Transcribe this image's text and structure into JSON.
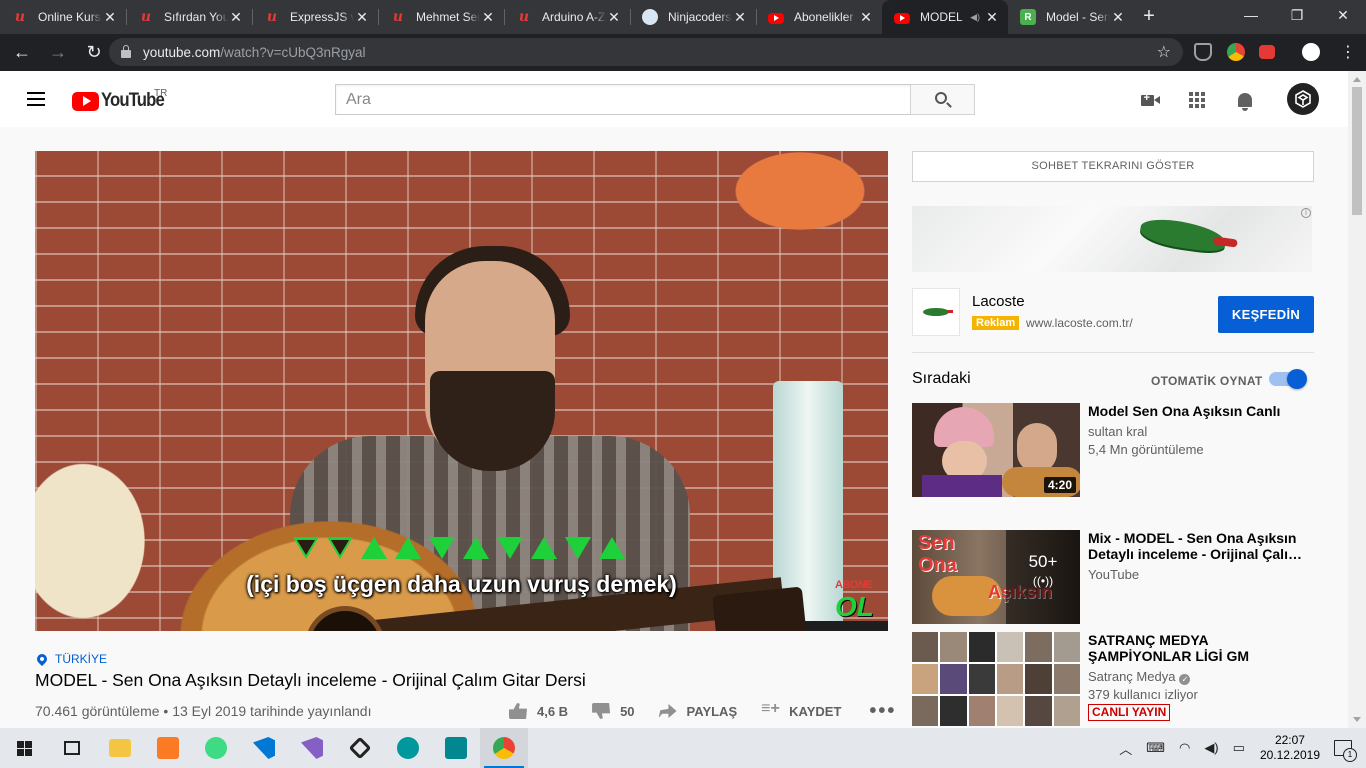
{
  "browser": {
    "tabs": [
      {
        "title": "Online Kurs",
        "favicon": "udemy-icon"
      },
      {
        "title": "Sıfırdan You",
        "favicon": "udemy-icon"
      },
      {
        "title": "ExpressJS ve",
        "favicon": "udemy-icon"
      },
      {
        "title": "Mehmet Sen",
        "favicon": "udemy-icon"
      },
      {
        "title": "Arduino A-Z",
        "favicon": "udemy-icon"
      },
      {
        "title": "Ninjacoders",
        "favicon": "ninjacoders-icon"
      },
      {
        "title": "Abonelikler",
        "favicon": "youtube-icon"
      },
      {
        "title": "MODEL",
        "favicon": "youtube-icon",
        "active": true,
        "playing_audio": true
      },
      {
        "title": "Model - Sen",
        "favicon": "r-icon"
      }
    ],
    "url_host": "youtube.com",
    "url_path": "/watch?v=cUbQ3nRgyal"
  },
  "masthead": {
    "logo_text": "YouTube",
    "region": "TR",
    "search_placeholder": "Ara"
  },
  "video": {
    "subtitle": "(içi boş üçgen daha uzun vuruş demek)",
    "watermark_top": "ABONE",
    "watermark_bottom": "OL",
    "strum_pattern": [
      "down-hollow",
      "down-hollow",
      "up",
      "up",
      "down",
      "up",
      "down",
      "up",
      "down",
      "up"
    ],
    "location": "TÜRKİYE",
    "title": "MODEL - Sen Ona Aşıksın Detaylı inceleme - Orijinal Çalım Gitar Dersi",
    "meta": "70.461 görüntüleme • 13 Eyl 2019 tarihinde yayınlandı",
    "likes": "4,6 B",
    "dislikes": "50",
    "share_label": "PAYLAŞ",
    "save_label": "KAYDET"
  },
  "sidebar": {
    "chat_replay_label": "SOHBET TEKRARINI GÖSTER",
    "ad": {
      "brand": "Lacoste",
      "badge": "Reklam",
      "url": "www.lacoste.com.tr/",
      "cta": "KEŞFEDİN"
    },
    "up_next_label": "Sıradaki",
    "autoplay_label": "OTOMATİK OYNAT",
    "autoplay_on": true,
    "cards": [
      {
        "title": "Model Sen Ona Aşıksın Canlı",
        "channel": "sultan kral",
        "meta": "5,4 Mn görüntüleme",
        "duration": "4:20"
      },
      {
        "title": "Mix - MODEL - Sen Ona Aşıksın Detaylı inceleme - Orijinal Çalı…",
        "channel": "YouTube",
        "mix_count": "50+",
        "thumb_text_1": "Sen",
        "thumb_text_2": "Ona",
        "thumb_text_3": "Aşıksın"
      },
      {
        "title": "SATRANÇ MEDYA ŞAMPİYONLAR LİGİ GM EMRE…",
        "channel": "Satranç Medya",
        "meta": "379 kullanıcı izliyor",
        "live_badge": "CANLI YAYIN"
      }
    ]
  },
  "taskbar": {
    "apps": [
      "start-icon",
      "task-view-icon",
      "file-explorer-icon",
      "xampp-icon",
      "android-studio-icon",
      "vscode-icon",
      "visual-studio-icon",
      "unity-icon",
      "arduino-icon",
      "arduino-ide-icon",
      "chrome-icon"
    ],
    "time": "22:07",
    "date": "20.12.2019"
  },
  "colors": {
    "youtube_red": "#ff0000",
    "link_blue": "#065fd4",
    "strum_green": "#1ed13a",
    "ad_badge": "#f5b400",
    "live_red": "#cc0000"
  }
}
